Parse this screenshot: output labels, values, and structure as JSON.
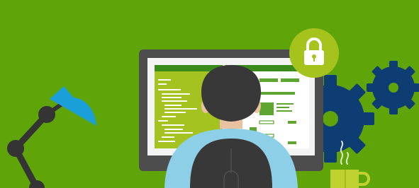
{
  "scene": {
    "kind": "flat-illustration",
    "colors": {
      "background": "#5fa50a",
      "lock_badge": "#a6c21d",
      "gear": "#0e3d73",
      "lamp_shade": "#1a9fd8",
      "lamp_arm": "#343434",
      "monitor_frame": "#4d4d4d",
      "code_panel": "#a4c321",
      "code_lines": "#ffffff",
      "window_bar": "#3a8a1c",
      "ui_green": "#5fa532",
      "hair": "#383838",
      "skin": "#e8c3a1",
      "shirt": "#8ccfe6",
      "vest": "#383838",
      "mug": "#bfd12f",
      "steam": "#dfe6c8"
    },
    "icons": [
      "desk-lamp-icon",
      "padlock-icon",
      "gear-icon",
      "coffee-mug-icon",
      "steam-icon"
    ]
  }
}
